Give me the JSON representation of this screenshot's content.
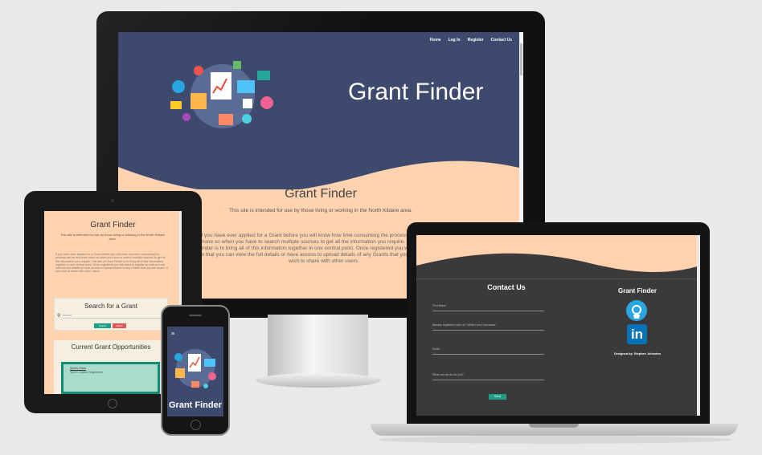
{
  "site": {
    "title": "Grant Finder",
    "nav": [
      "Home",
      "Log In",
      "Register",
      "Contact Us"
    ],
    "intro": "This site is intended for use by those living or working in the North Kildare area.",
    "body": "If you have ever applied for a Grant before you will know how time consuming the process can be and even more so when you have to search multiple sources to get all the information you require. This aim of Grant Finder is to bring all of this information together in one central point. Once registered you will need to register so that you can view the full details or have access to upload details of any Grants that you are aware of and wish to share with other users."
  },
  "tablet": {
    "search_heading": "Search for a Grant",
    "search_placeholder": "Search",
    "search_button": "Search",
    "reset_button": "Reset",
    "opps_heading": "Current Grant Opportunities",
    "card_title": "Sports Grant",
    "card_subtitle": "Sports Capital Programme"
  },
  "phone": {
    "menu_icon": "≡",
    "title": "Grant Finder"
  },
  "laptop": {
    "contact_heading": "Contact Us",
    "fields": [
      "First Name",
      "Already registered with us? What's your Username",
      "Email",
      "What can we do for you?"
    ],
    "send_button": "Send",
    "footer_title": "Grant Finder",
    "github_icon": "github-icon",
    "linkedin_icon": "in",
    "designed_by": "Designed by: Stephen Johnston"
  },
  "colors": {
    "navy": "#3e4a6d",
    "peach": "#ffd3b0",
    "teal": "#1e9e84",
    "dark": "#3a3a3a"
  }
}
